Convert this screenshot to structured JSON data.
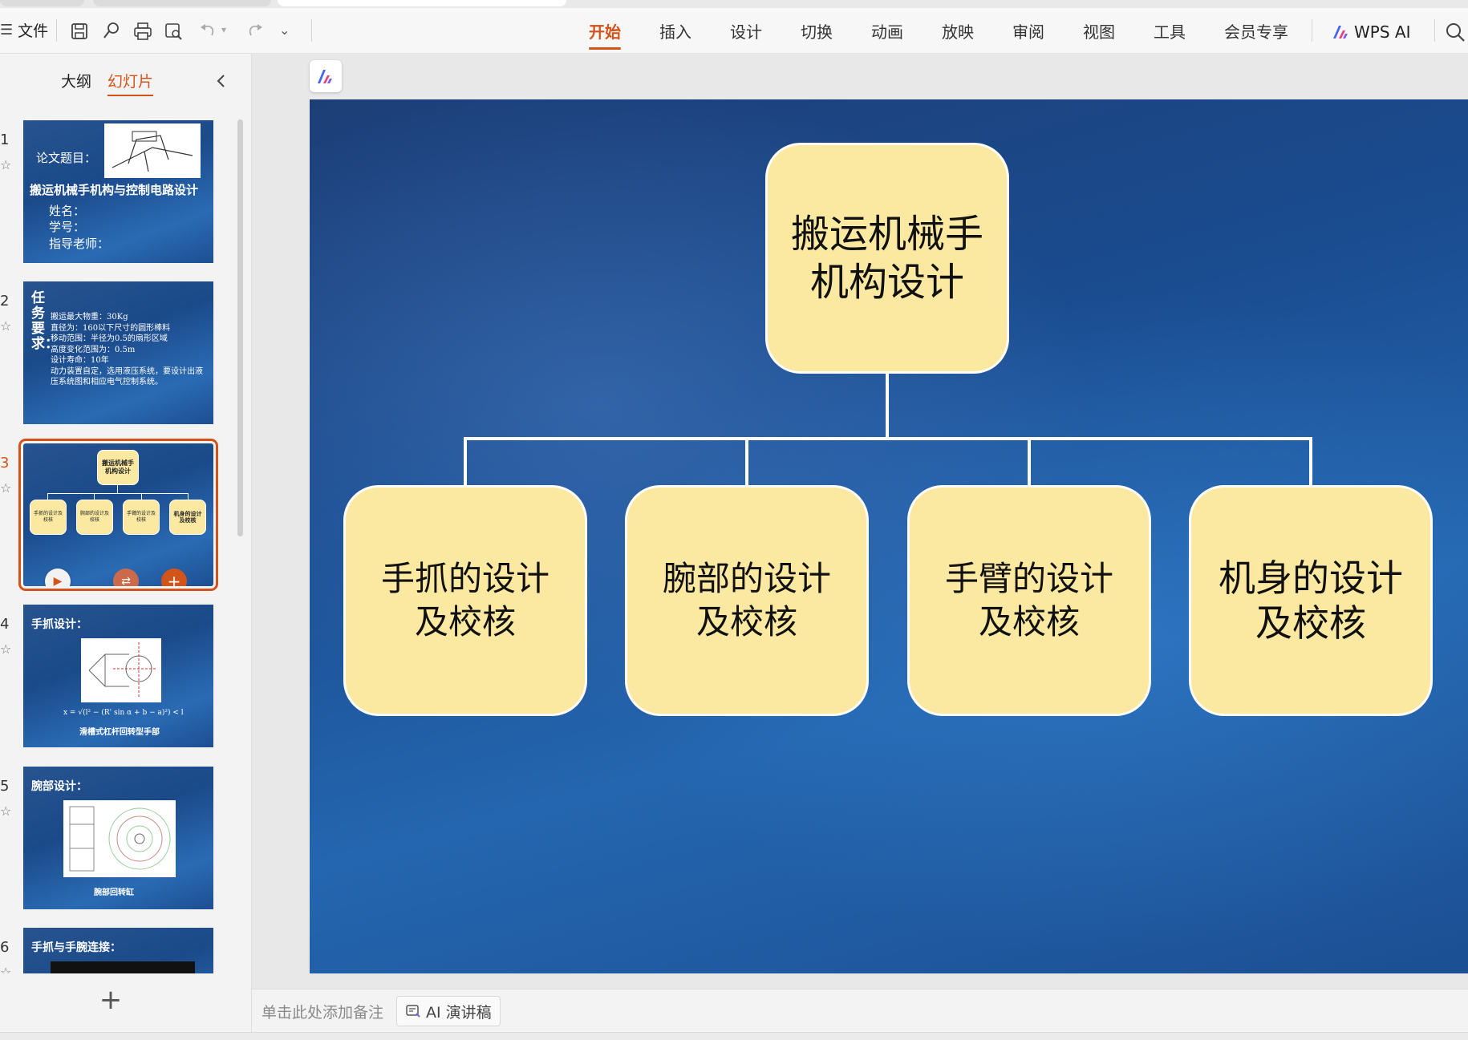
{
  "toolbar": {
    "file_label": "文件",
    "menu": [
      "开始",
      "插入",
      "设计",
      "切换",
      "动画",
      "放映",
      "审阅",
      "视图",
      "工具",
      "会员专享"
    ],
    "active_menu_index": 0,
    "wps_ai_label": "WPS AI",
    "accent_color": "#d2541a"
  },
  "left_panel": {
    "tabs": [
      "大纲",
      "幻灯片"
    ],
    "active_tab_index": 1
  },
  "thumbnails": [
    {
      "num": "1",
      "title": "论文题目：",
      "heading": "搬运机械手机构与控制电路设计",
      "lines": [
        "姓名：",
        "学号：",
        "指导老师："
      ]
    },
    {
      "num": "2",
      "vertical_title": "任务要求：",
      "lines": [
        "搬运最大物重：30Kg",
        "直径为：160以下尺寸的圆形棒料",
        "移动范围：半径为0.5的扇形区域",
        "高度变化范围为：0.5m",
        "设计寿命：10年",
        "动力装置自定，选用液压系统，要设计出液压系统图和相应电气控制系统。"
      ]
    },
    {
      "num": "3",
      "root": "搬运机械手机构设计",
      "children": [
        "手抓的设计及校核",
        "腕部的设计及校核",
        "手臂的设计及校核",
        "机身的设计及校核"
      ]
    },
    {
      "num": "4",
      "title": "手抓设计：",
      "formula": "x = √(l² − (R' sin α + b − a)²) < l",
      "caption": "滑槽式杠杆回转型手部"
    },
    {
      "num": "5",
      "title": "腕部设计：",
      "caption": "腕部回转缸"
    },
    {
      "num": "6",
      "title": "手抓与手腕连接："
    }
  ],
  "slide": {
    "root": {
      "line1": "搬运机械手",
      "line2": "机构设计"
    },
    "children": [
      {
        "line1": "手抓的设计",
        "line2": "及校核"
      },
      {
        "line1": "腕部的设计",
        "line2": "及校核"
      },
      {
        "line1": "手臂的设计",
        "line2": "及校核"
      },
      {
        "line1": "机身的设计",
        "line2": "及校核"
      }
    ],
    "box_fill": "#fbe9a2"
  },
  "notes": {
    "placeholder": "单击此处添加备注",
    "ai_script_label": "AI 演讲稿"
  }
}
